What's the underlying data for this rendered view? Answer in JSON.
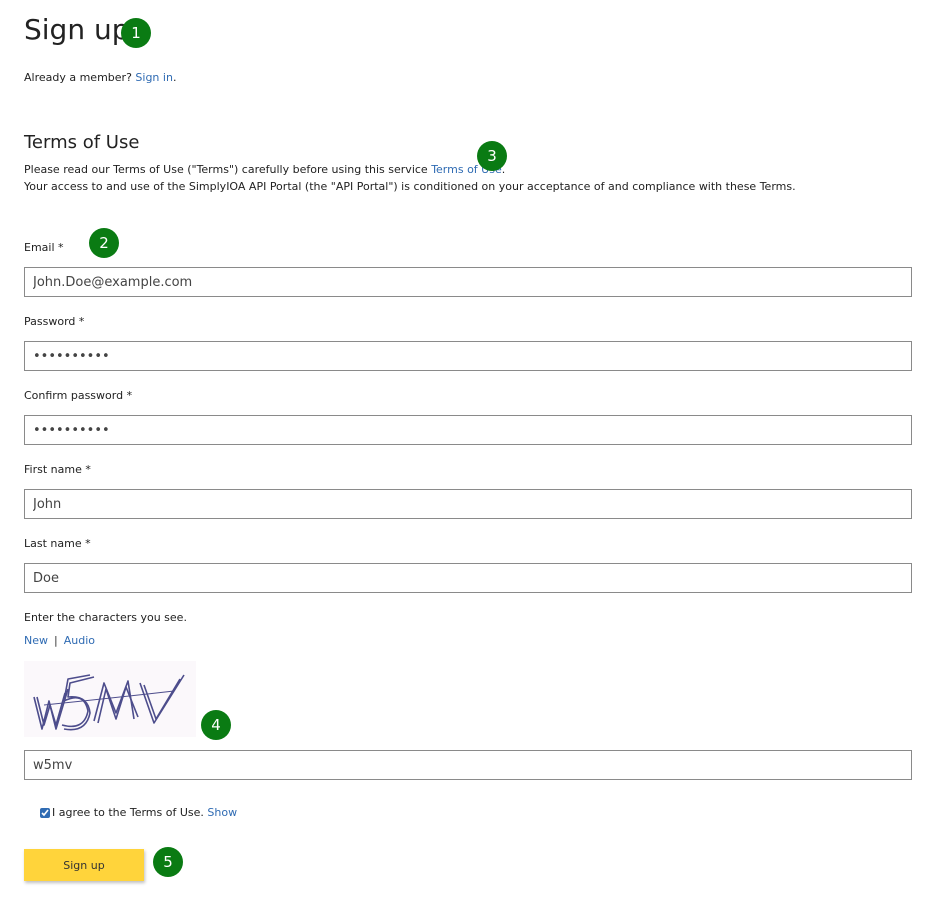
{
  "page": {
    "title": "Sign up"
  },
  "member": {
    "prompt": "Already a member?",
    "sign_in_link": "Sign in",
    "suffix": "."
  },
  "terms": {
    "heading": "Terms of Use",
    "line1_prefix": "Please read our Terms of Use (\"Terms\") carefully before using this service",
    "line1_link": "Terms of Use",
    "line1_suffix": ".",
    "line2": "Your access to and use of the SimplyIOA API Portal (the \"API Portal\") is conditioned on your acceptance of and compliance with these Terms."
  },
  "form": {
    "email_label": "Email *",
    "email_value": "John.Doe@example.com",
    "password_label": "Password *",
    "password_value": "••••••••••",
    "confirm_label": "Confirm password *",
    "confirm_value": "••••••••••",
    "first_name_label": "First name *",
    "first_name_value": "John",
    "last_name_label": "Last name *",
    "last_name_value": "Doe"
  },
  "captcha": {
    "instruction": "Enter the characters you see.",
    "new_link": "New",
    "separator": "|",
    "audio_link": "Audio",
    "image_text": "W5MV",
    "input_value": "w5mv"
  },
  "agree": {
    "checked": true,
    "label": "I agree to the Terms of Use.",
    "show_link": "Show"
  },
  "submit": {
    "label": "Sign up"
  },
  "badges": [
    "1",
    "2",
    "3",
    "4",
    "5"
  ],
  "colors": {
    "link": "#2f6bb3",
    "badge": "#0a7b13",
    "button": "#ffd43b"
  }
}
